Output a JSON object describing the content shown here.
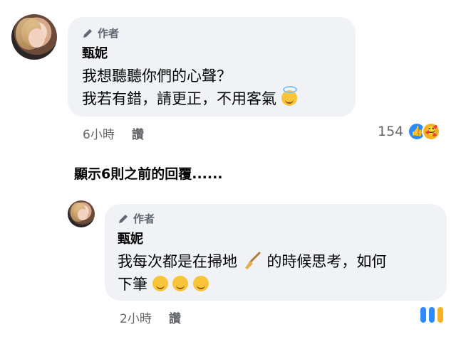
{
  "comment1": {
    "author_badge": "作者",
    "name": "甄妮",
    "line1": "我想聽聽你們的心聲？",
    "line2": "我若有錯，請更正，不用客氣",
    "time": "6小時",
    "reply": "讚",
    "reactions_count": "154",
    "reaction_icons": [
      "like-icon",
      "care-icon"
    ],
    "emoji": "smiling-face-with-halo-icon"
  },
  "view_more": "顯示6則之前的回覆......",
  "reply1": {
    "author_badge": "作者",
    "name": "甄妮",
    "line1_a": "我每次都是在掃地",
    "line1_b": "的時候思考，如何",
    "line2": "下筆",
    "time": "2小時",
    "reply": "讚",
    "emojis": [
      "rolling-on-floor-laughing-icon",
      "rolling-on-floor-laughing-icon",
      "rolling-on-floor-laughing-icon"
    ],
    "inline_icon": "broom-icon"
  },
  "colors": {
    "bubble": "#f0f2f5",
    "meta_text": "#65676b",
    "like": "#2e89ff",
    "care": "#f7b125"
  }
}
